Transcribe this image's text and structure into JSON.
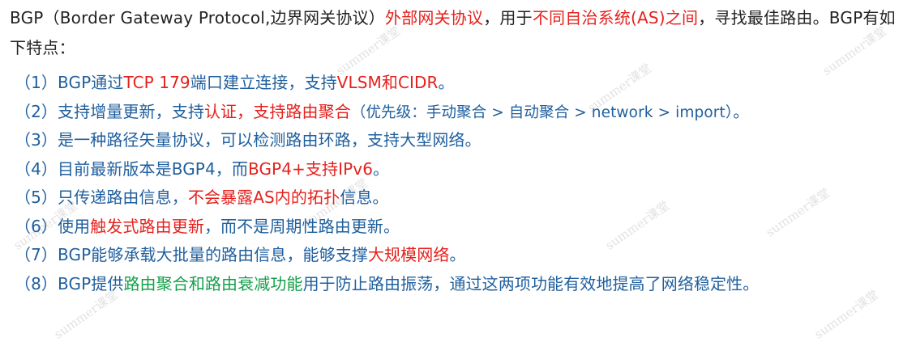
{
  "intro": {
    "p1": "BGP（Border Gateway Protocol,边界网关协议）",
    "p2_red": "外部网关协议",
    "p3": "，用于",
    "p4_red": "不同自治系统(AS)之间",
    "p5": "，寻找最佳路由。BGP有如下特点："
  },
  "items": {
    "i1": {
      "a": "（1）BGP通过",
      "b": "TCP 179",
      "c": "端口建立连接，支持",
      "d": "VLSM和CIDR",
      "e": "。"
    },
    "i2": {
      "a": "（2）支持增量更新，支持",
      "b": "认证，支持路由聚合",
      "c": "（优先级：手动聚合 > 自动聚合 > network > import）",
      "d": "。"
    },
    "i3": {
      "a": "（3）是一种路径矢量协议，可以检测路由环路，支持大型网络。"
    },
    "i4": {
      "a": "（4）目前最新版本是BGP4，而",
      "b": "BGP4+支持IPv6",
      "c": "。"
    },
    "i5": {
      "a": "（5）只传递路由信息，",
      "b": "不会暴露AS内的拓扑",
      "c": "信息。"
    },
    "i6": {
      "a": "（6）使用",
      "b": "触发式路由更新",
      "c": "，而不是周期性路由更新。"
    },
    "i7": {
      "a": "（7）BGP能够承载大批量的路由信息，能够支撑",
      "b": "大规模网络",
      "c": "。"
    },
    "i8": {
      "a": "（8）BGP提供",
      "b": "路由聚合和路由衰减功能",
      "c": "用于防止路由振荡，通过这两项功能有效地提高了网络稳定性。"
    }
  },
  "watermark": "summer课堂",
  "colors": {
    "text": "#222222",
    "blue": "#1f5f9e",
    "red": "#e5211d",
    "green": "#14a04a"
  }
}
